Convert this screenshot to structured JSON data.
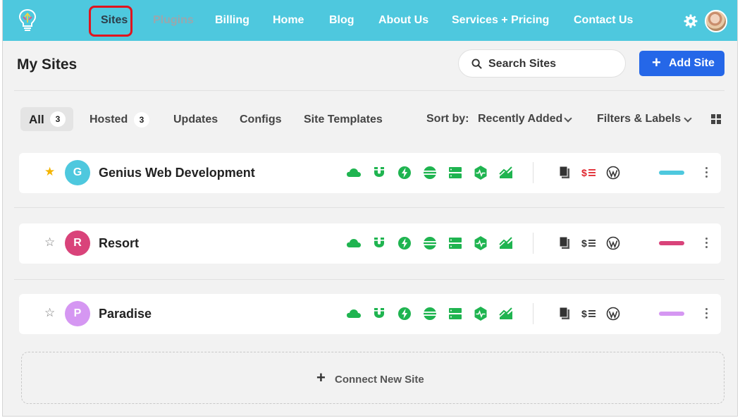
{
  "nav": {
    "items": [
      {
        "label": "Sites"
      },
      {
        "label": "Plugins"
      },
      {
        "label": "Billing"
      },
      {
        "label": "Home"
      },
      {
        "label": "Blog"
      },
      {
        "label": "About Us"
      },
      {
        "label": "Services + Pricing"
      },
      {
        "label": "Contact Us"
      }
    ],
    "active": "Sites",
    "colors": {
      "bar": "#4ec8de",
      "highlight": "#e0141e"
    }
  },
  "header": {
    "title": "My Sites",
    "search_placeholder": "Search Sites",
    "add_label": "Add Site"
  },
  "filters": {
    "tabs": [
      {
        "label": "All",
        "count": "3"
      },
      {
        "label": "Hosted",
        "count": "3"
      },
      {
        "label": "Updates"
      },
      {
        "label": "Configs"
      },
      {
        "label": "Site Templates"
      }
    ],
    "sort_label": "Sort by:",
    "sort_value": "Recently Added",
    "filters_label": "Filters & Labels"
  },
  "sites": [
    {
      "initial": "G",
      "name": "Genius Web Development",
      "favorite": true,
      "color": "#4ec8de"
    },
    {
      "initial": "R",
      "name": "Resort",
      "favorite": false,
      "color": "#d9437a"
    },
    {
      "initial": "P",
      "name": "Paradise",
      "favorite": false,
      "color": "#d597f2"
    }
  ],
  "tool_icons": [
    "cloud-icon",
    "magnet-icon",
    "bolt-icon",
    "stack-icon",
    "server-icon",
    "heartbeat-icon",
    "chart-icon"
  ],
  "meta_icons": [
    "copy-icon",
    "billing-icon",
    "wordpress-icon"
  ],
  "connect": {
    "label": "Connect New Site"
  },
  "accent_green": "#1fb450",
  "accent_blue": "#2567e8"
}
